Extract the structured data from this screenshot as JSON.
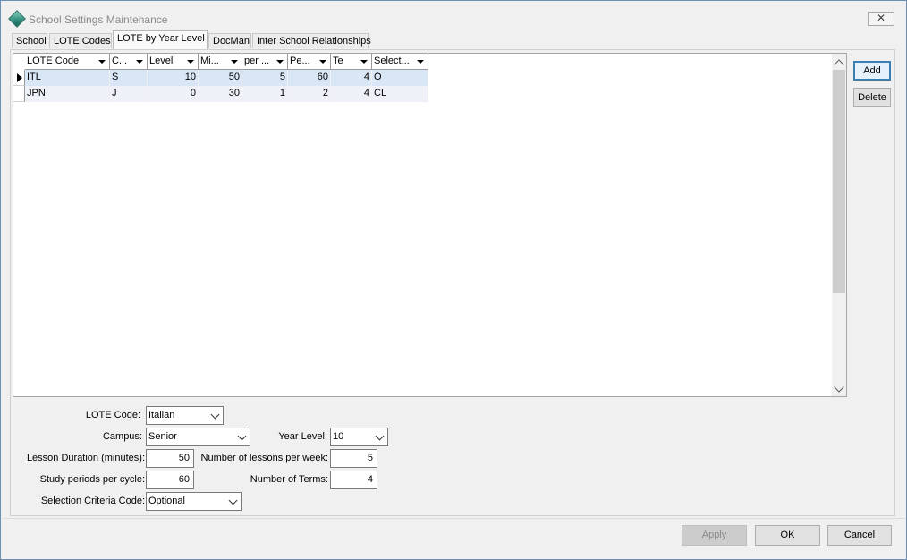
{
  "window": {
    "title": "School Settings Maintenance",
    "close_glyph": "✕"
  },
  "tabs": [
    {
      "label": "School",
      "active": false
    },
    {
      "label": "LOTE Codes",
      "active": false
    },
    {
      "label": "LOTE by Year Level",
      "active": true
    },
    {
      "label": "DocMan",
      "active": false
    },
    {
      "label": "Inter School Relationships",
      "active": false
    }
  ],
  "grid": {
    "columns": [
      "LOTE Code",
      "C...",
      "Level",
      "Mi...",
      "per ...",
      "Pe...",
      "Te",
      "Select..."
    ],
    "rows": [
      {
        "cells": [
          "ITL",
          "S",
          "10",
          "50",
          "5",
          "60",
          "4",
          "O"
        ],
        "selected": true
      },
      {
        "cells": [
          "JPN",
          "J",
          "0",
          "30",
          "1",
          "2",
          "4",
          "CL"
        ],
        "selected": false
      }
    ]
  },
  "side_buttons": {
    "add": "Add",
    "delete": "Delete"
  },
  "form": {
    "lote_code_label": "LOTE Code:",
    "lote_code_value": "Italian",
    "campus_label": "Campus:",
    "campus_value": "Senior",
    "year_level_label": "Year Level:",
    "year_level_value": "10",
    "lesson_duration_label": "Lesson Duration (minutes):",
    "lesson_duration_value": "50",
    "lessons_per_week_label": "Number of lessons per week:",
    "lessons_per_week_value": "5",
    "study_periods_label": "Study periods per cycle:",
    "study_periods_value": "60",
    "terms_label": "Number of Terms:",
    "terms_value": "4",
    "selection_criteria_label": "Selection Criteria Code:",
    "selection_criteria_value": "Optional"
  },
  "footer": {
    "apply": "Apply",
    "ok": "OK",
    "cancel": "Cancel"
  },
  "colors": {
    "selected_row": "#d8e6f5",
    "primary_button_border": "#3c7fb1"
  }
}
